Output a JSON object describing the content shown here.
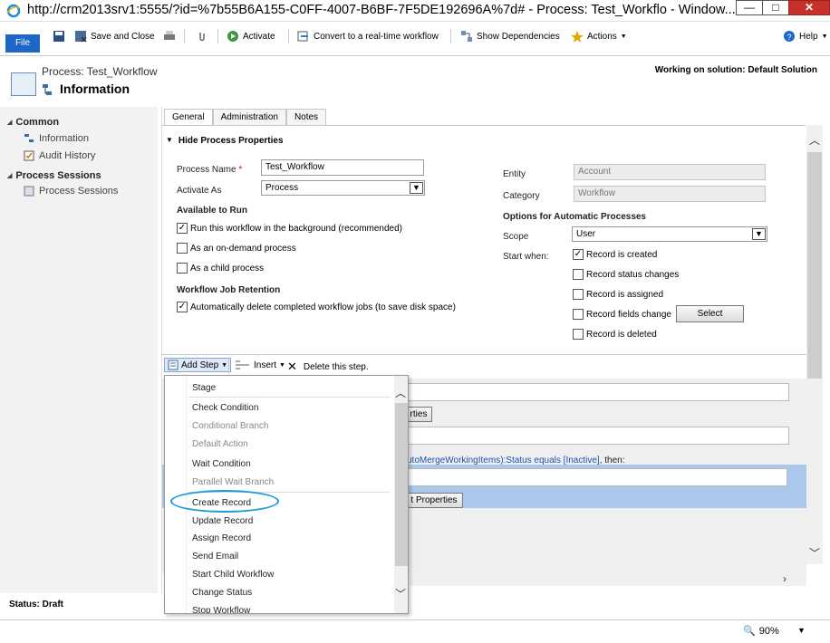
{
  "window": {
    "title": "http://crm2013srv1:5555/?id=%7b55B6A155-C0FF-4007-B6BF-7F5DE192696A%7d# - Process: Test_Workflo - Window...",
    "minimize": "—",
    "maximize": "□",
    "close": "✕"
  },
  "ribbon": {
    "file": "File",
    "save_and_close": "Save and Close",
    "activate": "Activate",
    "convert": "Convert to a real-time workflow",
    "show_dependencies": "Show Dependencies",
    "actions": "Actions",
    "help": "Help"
  },
  "header": {
    "entity": "Process: Test_Workflow",
    "form_name": "Information",
    "solution": "Working on solution: Default Solution"
  },
  "nav": {
    "common": "Common",
    "information": "Information",
    "audit_history": "Audit History",
    "process_sessions_header": "Process Sessions",
    "process_sessions": "Process Sessions"
  },
  "status": "Status: Draft",
  "tabs": [
    "General",
    "Administration",
    "Notes"
  ],
  "section": {
    "title": "Hide Process Properties",
    "process_name_label": "Process Name",
    "process_name_value": "Test_Workflow",
    "required": "*",
    "activate_as_label": "Activate As",
    "activate_as_value": "Process",
    "available_to_run": "Available to Run",
    "run_background": "Run this workflow in the background (recommended)",
    "on_demand": "As an on-demand process",
    "child_process": "As a child process",
    "retention_title": "Workflow Job Retention",
    "auto_delete": "Automatically delete completed workflow jobs (to save disk space)",
    "entity_label": "Entity",
    "entity_value": "Account",
    "category_label": "Category",
    "category_value": "Workflow",
    "options_title": "Options for Automatic Processes",
    "scope_label": "Scope",
    "scope_value": "User",
    "start_when_label": "Start when:",
    "record_created": "Record is created",
    "record_status": "Record status changes",
    "record_assigned": "Record is assigned",
    "record_fields": "Record fields change",
    "select": "Select",
    "record_deleted": "Record is deleted",
    "check": "✓"
  },
  "step_toolbar": {
    "add_step": "Add Step",
    "insert": "Insert",
    "delete": "Delete this step."
  },
  "designer": {
    "properties_btn_1": "rties",
    "condition_text": "utoMergeWorkingItems):Status equals [Inactive]",
    "condition_then": ", then:",
    "properties_btn_2": "t Properties"
  },
  "menu": {
    "stage": "Stage",
    "check_condition": "Check Condition",
    "conditional_branch": "Conditional Branch",
    "default_action": "Default Action",
    "wait_condition": "Wait Condition",
    "parallel_wait_branch": "Parallel Wait Branch",
    "create_record": "Create Record",
    "update_record": "Update Record",
    "assign_record": "Assign Record",
    "send_email": "Send Email",
    "start_child_workflow": "Start Child Workflow",
    "change_status": "Change Status",
    "stop_workflow": "Stop Workflow"
  },
  "zoom": "90%",
  "accent": "#1e67c6",
  "highlight_oval": "#1e9bd7"
}
